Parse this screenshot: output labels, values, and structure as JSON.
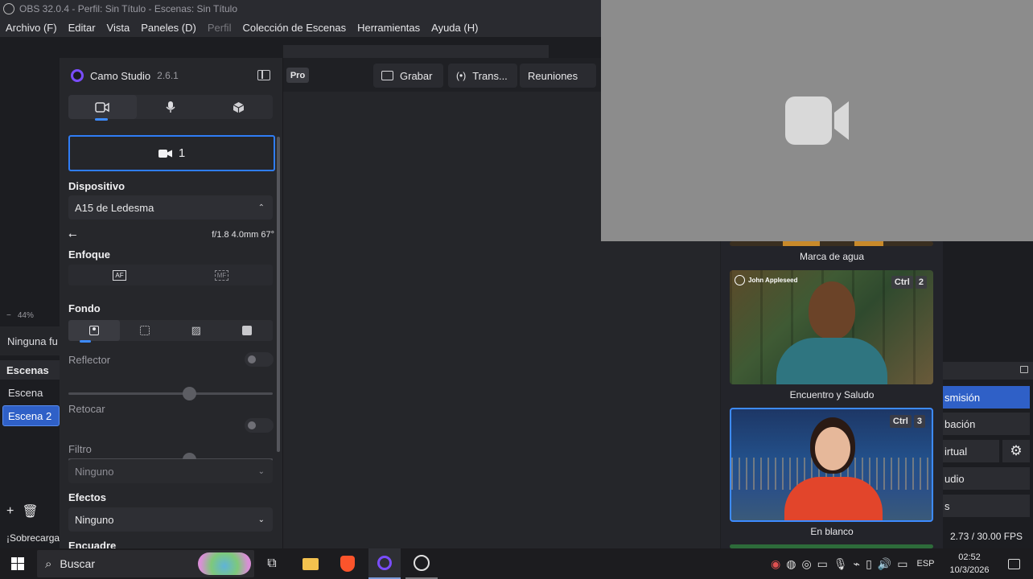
{
  "obs": {
    "title": "OBS 32.0.4 - Perfil: Sin Título - Escenas: Sin Título",
    "menu": [
      "Archivo (F)",
      "Editar",
      "Vista",
      "Paneles (D)",
      "Perfil",
      "Colección de Escenas",
      "Herramientas",
      "Ayuda (H)"
    ],
    "zoom": "44%",
    "no_source": "Ninguna fu",
    "scenes_header": "Escenas",
    "scenes": [
      "Escena",
      "Escena 2"
    ],
    "status_left": "¡Sobrecarga",
    "fps": "2.73 / 30.00 FPS",
    "controls": [
      "smisión",
      "bación",
      "irtual",
      "udio",
      "s"
    ]
  },
  "camo": {
    "app_name": "Camo Studio",
    "version": "2.6.1",
    "pro_badge": "Pro",
    "camera_label": "1",
    "device_section": "Dispositivo",
    "device_value": "A15 de Ledesma",
    "lens_info": "f/1.8 4.0mm 67°",
    "focus_section": "Enfoque",
    "background_section": "Fondo",
    "reflector_label": "Reflector",
    "reflector_level": 0.6,
    "retouch_label": "Retocar",
    "retouch_level": 0.6,
    "filter_label": "Filtro",
    "filter_value": "Ninguno",
    "effects_label": "Efectos",
    "effects_value": "Ninguno",
    "framing_label": "Encuadre",
    "toolbar": {
      "record": "Grabar",
      "stream": "Trans...",
      "meetings": "Reuniones"
    }
  },
  "scene_cards": [
    {
      "label": "Marca de agua"
    },
    {
      "label": "Encuentro y Saludo",
      "shortcut": [
        "Ctrl",
        "2"
      ],
      "name_overlay": "John Appleseed"
    },
    {
      "label": "En blanco",
      "shortcut": [
        "Ctrl",
        "3"
      ]
    }
  ],
  "taskbar": {
    "search": "Buscar",
    "lang": "ESP",
    "time": "02:52",
    "date": "10/3/2026"
  },
  "colors": {
    "accent": "#2f7df6",
    "logo": "#7a4dff",
    "brave": "#fb542b"
  }
}
